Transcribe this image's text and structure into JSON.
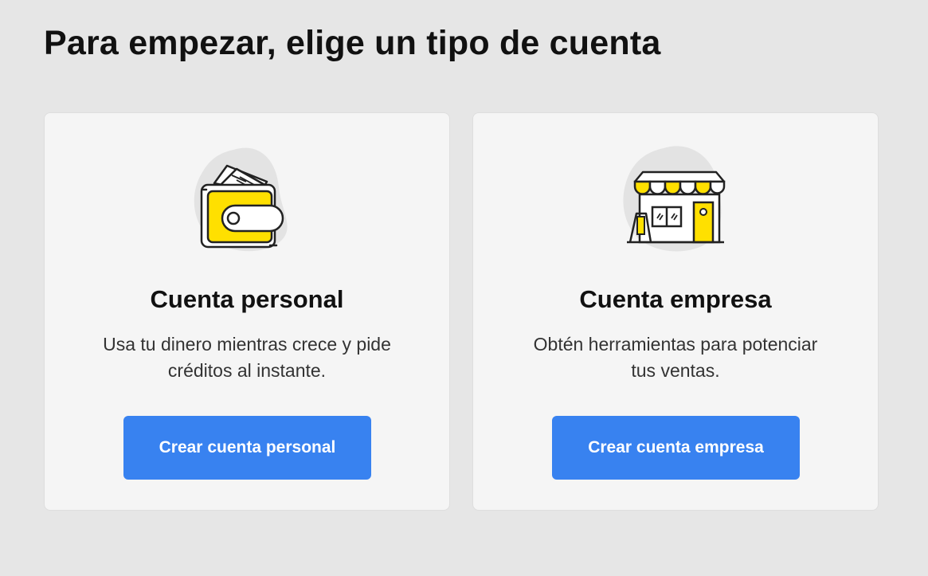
{
  "page": {
    "title": "Para empezar, elige un tipo de cuenta"
  },
  "cards": [
    {
      "icon": "wallet-icon",
      "title": "Cuenta personal",
      "description": "Usa tu dinero mientras crece y pide créditos al instante.",
      "button_label": "Crear cuenta personal"
    },
    {
      "icon": "store-icon",
      "title": "Cuenta empresa",
      "description": "Obtén herramientas para potenciar tus ventas.",
      "button_label": "Crear cuenta empresa"
    }
  ],
  "colors": {
    "background": "#e6e6e6",
    "card": "#f5f5f5",
    "button": "#3882f0",
    "accent_yellow": "#ffe000"
  }
}
